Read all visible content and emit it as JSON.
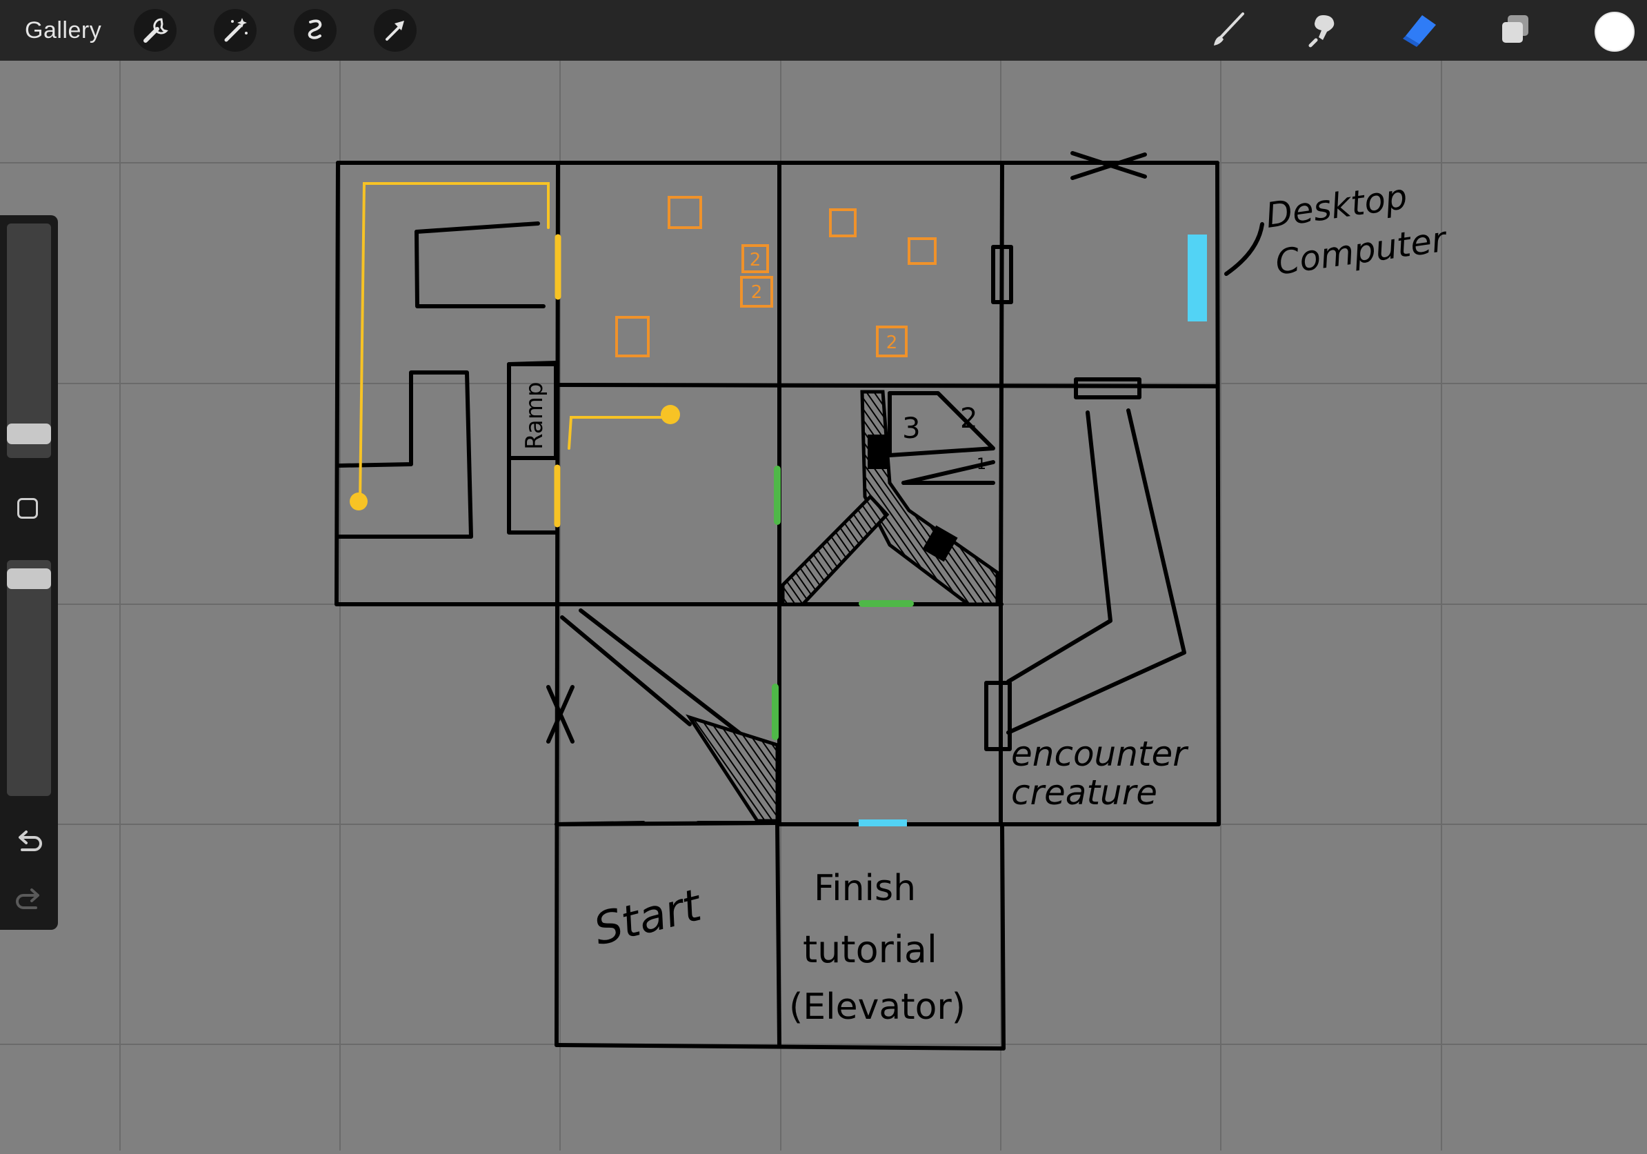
{
  "topbar": {
    "gallery_label": "Gallery",
    "left_tools": [
      {
        "name": "actions-wrench-icon"
      },
      {
        "name": "adjustments-magic-wand-icon"
      },
      {
        "name": "selection-icon"
      },
      {
        "name": "transform-arrow-icon"
      }
    ],
    "right_tools": [
      {
        "name": "brush-icon"
      },
      {
        "name": "smudge-icon"
      },
      {
        "name": "eraser-icon",
        "active": true,
        "color": "#2f7cf6"
      },
      {
        "name": "layers-icon"
      }
    ],
    "current_color": "#ffffff"
  },
  "sidebar": {
    "brush_size_level": 0.22,
    "opacity_level": 0.93,
    "icons": [
      "modify-square-icon",
      "undo-icon",
      "redo-icon"
    ]
  },
  "canvas": {
    "background": "#808080",
    "colors": {
      "ink": "#000000",
      "yellow": "#f7c325",
      "orange": "#f0922a",
      "green": "#4fb848",
      "cyan": "#52d3f5"
    },
    "labels": {
      "ramp": "Ramp",
      "desktop": "Desktop",
      "computer": "Computer",
      "num3": "3",
      "num2": "2",
      "num1": "1",
      "box_num": "2",
      "encounter": "encounter",
      "creature": "creature",
      "start": "Start",
      "finish": "Finish",
      "tutorial": "tutorial",
      "elevator": "(Elevator)"
    }
  }
}
